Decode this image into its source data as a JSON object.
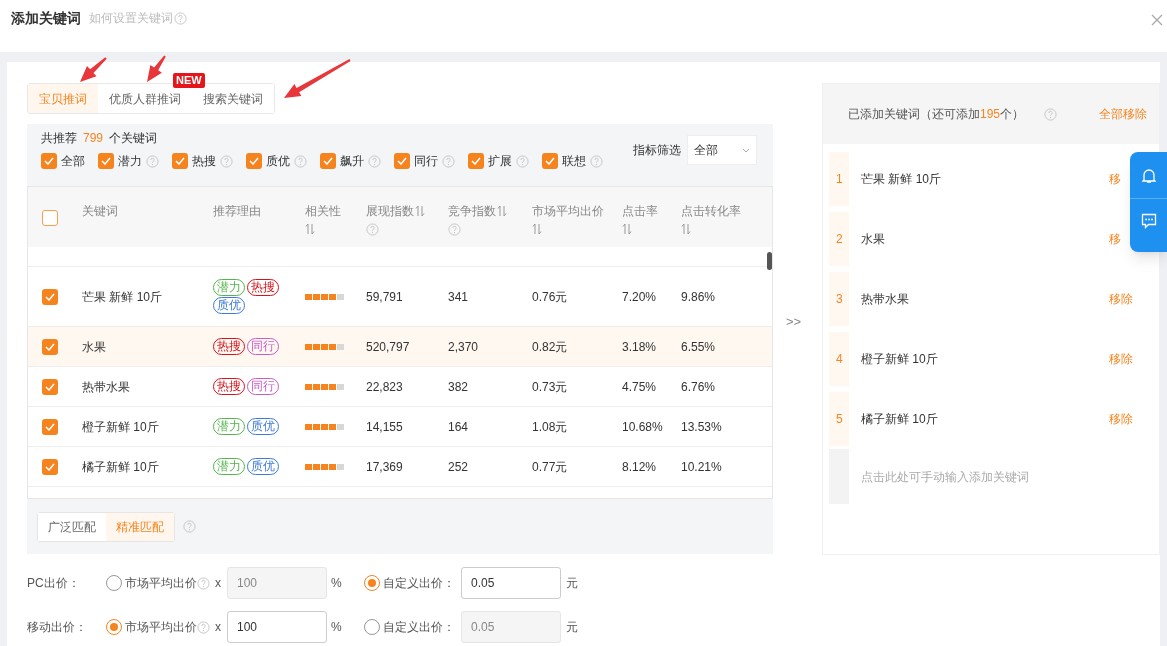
{
  "dialog": {
    "title": "添加关键词",
    "help_link": "如何设置关键词"
  },
  "tabs": [
    {
      "label": "宝贝推词",
      "selected": true
    },
    {
      "label": "优质人群推词",
      "selected": false,
      "badge": "NEW"
    },
    {
      "label": "搜索关键词",
      "selected": false
    }
  ],
  "filter": {
    "summary_prefix": "共推荐",
    "count": "799",
    "summary_suffix": "个关键词",
    "metric_label": "指标筛选",
    "metric_value": "全部",
    "options": [
      {
        "label": "全部",
        "checked": true,
        "help": false
      },
      {
        "label": "潜力",
        "checked": true,
        "help": true
      },
      {
        "label": "热搜",
        "checked": true,
        "help": true
      },
      {
        "label": "质优",
        "checked": true,
        "help": true
      },
      {
        "label": "飙升",
        "checked": true,
        "help": true
      },
      {
        "label": "同行",
        "checked": true,
        "help": true
      },
      {
        "label": "扩展",
        "checked": true,
        "help": true
      },
      {
        "label": "联想",
        "checked": true,
        "help": true
      }
    ]
  },
  "table": {
    "select_all": false,
    "columns": [
      {
        "label": "关键词",
        "sortable": false,
        "help": false
      },
      {
        "label": "推荐理由",
        "sortable": false,
        "help": false
      },
      {
        "label": "相关性",
        "sortable": true,
        "help": false
      },
      {
        "label": "展现指数",
        "sortable": true,
        "help": true
      },
      {
        "label": "竞争指数",
        "sortable": true,
        "help": true
      },
      {
        "label": "市场平均出价",
        "sortable": true,
        "help": false
      },
      {
        "label": "点击率",
        "sortable": true,
        "help": false
      },
      {
        "label": "点击转化率",
        "sortable": true,
        "help": false
      }
    ],
    "rows": [
      {
        "checked": true,
        "highlighted": false,
        "keyword": "芒果 新鲜 10斤",
        "reasons": [
          {
            "label": "潜力",
            "color": "#52b64a"
          },
          {
            "label": "热搜",
            "color": "#d4131c"
          },
          {
            "label": "质优",
            "color": "#3d7ad8"
          }
        ],
        "stars": 4,
        "impressions": "59,791",
        "competition": "341",
        "avg_price": "0.76元",
        "ctr": "7.20%",
        "cvr": "9.86%"
      },
      {
        "checked": true,
        "highlighted": true,
        "keyword": "水果",
        "reasons": [
          {
            "label": "热搜",
            "color": "#d4131c"
          },
          {
            "label": "同行",
            "color": "#c85cc8"
          }
        ],
        "stars": 4,
        "impressions": "520,797",
        "competition": "2,370",
        "avg_price": "0.82元",
        "ctr": "3.18%",
        "cvr": "6.55%"
      },
      {
        "checked": true,
        "highlighted": false,
        "keyword": "热带水果",
        "reasons": [
          {
            "label": "热搜",
            "color": "#d4131c"
          },
          {
            "label": "同行",
            "color": "#c85cc8"
          }
        ],
        "stars": 4,
        "impressions": "22,823",
        "competition": "382",
        "avg_price": "0.73元",
        "ctr": "4.75%",
        "cvr": "6.76%"
      },
      {
        "checked": true,
        "highlighted": false,
        "keyword": "橙子新鲜 10斤",
        "reasons": [
          {
            "label": "潜力",
            "color": "#52b64a"
          },
          {
            "label": "质优",
            "color": "#3d7ad8"
          }
        ],
        "stars": 4,
        "impressions": "14,155",
        "competition": "164",
        "avg_price": "1.08元",
        "ctr": "10.68%",
        "cvr": "13.53%"
      },
      {
        "checked": true,
        "highlighted": false,
        "keyword": "橘子新鲜 10斤",
        "reasons": [
          {
            "label": "潜力",
            "color": "#52b64a"
          },
          {
            "label": "质优",
            "color": "#3d7ad8"
          }
        ],
        "stars": 4,
        "impressions": "17,369",
        "competition": "252",
        "avg_price": "0.77元",
        "ctr": "8.12%",
        "cvr": "10.21%"
      }
    ]
  },
  "match_types": [
    {
      "label": "广泛匹配",
      "selected": false
    },
    {
      "label": "精准匹配",
      "selected": true
    }
  ],
  "bids": [
    {
      "label": "PC出价：",
      "market_label": "市场平均出价",
      "times": "x",
      "market_value": "100",
      "market_unit": "%",
      "custom_label": "自定义出价：",
      "custom_value": "0.05",
      "custom_unit": "元",
      "market_selected": false,
      "custom_selected": true
    },
    {
      "label": "移动出价：",
      "market_label": "市场平均出价",
      "times": "x",
      "market_value": "100",
      "market_unit": "%",
      "custom_label": "自定义出价：",
      "custom_value": "0.05",
      "custom_unit": "元",
      "market_selected": true,
      "custom_selected": false
    }
  ],
  "transfer": ">>",
  "added": {
    "title_prefix": "已添加关键词（还可添加",
    "remaining": "195",
    "title_suffix": "个）",
    "remove_all": "全部移除",
    "placeholder": "点击此处可手动输入添加关键词",
    "items": [
      {
        "index": "1",
        "keyword": "芒果 新鲜 10斤",
        "remove": "移"
      },
      {
        "index": "2",
        "keyword": "水果",
        "remove": "移"
      },
      {
        "index": "3",
        "keyword": "热带水果",
        "remove": "移除"
      },
      {
        "index": "4",
        "keyword": "橙子新鲜 10斤",
        "remove": "移除"
      },
      {
        "index": "5",
        "keyword": "橘子新鲜 10斤",
        "remove": "移除"
      }
    ]
  }
}
